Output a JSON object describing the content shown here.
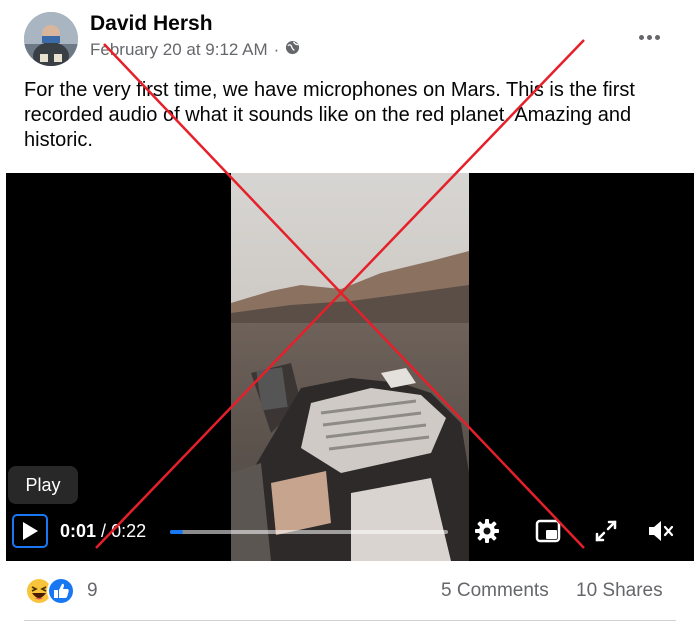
{
  "post": {
    "author": "David Hersh",
    "date": "February 20 at 9:12 AM",
    "separator": "·",
    "privacy_icon": "globe-icon",
    "more_icon": "more-options-icon",
    "text": "For the very first time, we have microphones on Mars. This is the first recorded audio of what it sounds like on the red planet. Amazing and historic."
  },
  "video": {
    "tooltip": "Play",
    "current_time": "0:01",
    "time_separator": "/",
    "duration": "0:22",
    "progress_fraction": 0.045,
    "icons": [
      "play-icon",
      "settings-icon",
      "picture-in-picture-icon",
      "fullscreen-icon",
      "mute-icon"
    ]
  },
  "footer": {
    "reaction_icons": [
      "haha-icon",
      "like-icon"
    ],
    "reaction_count": "9",
    "comments": "5 Comments",
    "shares": "10 Shares"
  },
  "colors": {
    "brand_blue": "#1877f2",
    "cross_red": "#e5202a",
    "muted_text": "#65676b"
  }
}
